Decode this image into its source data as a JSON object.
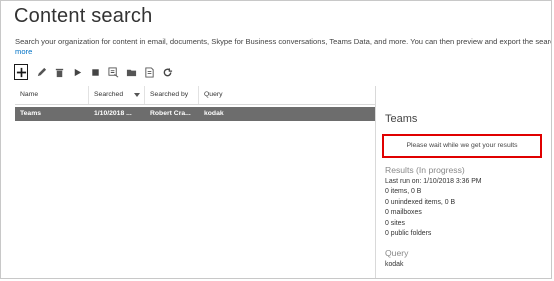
{
  "header": {
    "title": "Content search",
    "description": "Search your organization for content in email, documents, Skype for Business conversations, Teams Data, and more. You can then preview and export the search",
    "more_link": "more"
  },
  "toolbar": {
    "icons": [
      "plus-icon",
      "pencil-icon",
      "trash-icon",
      "play-icon",
      "stop-icon",
      "export-report-icon",
      "folder-icon",
      "document-icon",
      "refresh-icon"
    ]
  },
  "grid": {
    "columns": [
      "Name",
      "Searched",
      "Searched by",
      "Query"
    ],
    "rows": [
      {
        "name": "Teams",
        "searched": "1/10/2018 ...",
        "searched_by": "Robert Cra...",
        "query": "kodak"
      }
    ]
  },
  "details": {
    "title": "Teams",
    "wait_message": "Please wait while we get your results",
    "results_heading": "Results   (In progress)",
    "results": [
      "Last run on: 1/10/2018 3:36 PM",
      "0 items, 0 B",
      "0 unindexed items, 0 B",
      "0 mailboxes",
      "0 sites",
      "0 public folders"
    ],
    "query_heading": "Query",
    "query_value": "kodak"
  },
  "colors": {
    "highlight_border": "#e00000",
    "selected_row": "#6d6d6d",
    "link": "#0072c6"
  }
}
